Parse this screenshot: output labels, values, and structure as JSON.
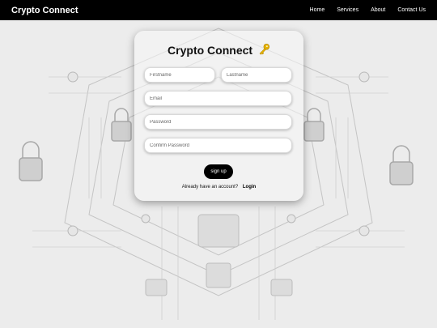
{
  "nav": {
    "brand": "Crypto Connect",
    "links": [
      "Home",
      "Services",
      "About",
      "Contact Us"
    ]
  },
  "card": {
    "title": "Crypto Connect",
    "icon": "key-icon",
    "fields": {
      "firstname_placeholder": "Firstname",
      "lastname_placeholder": "Lastname",
      "email_placeholder": "Email",
      "password_placeholder": "Password",
      "confirm_placeholder": "Confirm Password"
    },
    "signup_label": "sign up",
    "account_prompt": "Already have an account?",
    "login_label": "Login"
  },
  "colors": {
    "navbar": "#000000",
    "background": "#ececec",
    "button": "#000000",
    "key": "#e8b400"
  }
}
